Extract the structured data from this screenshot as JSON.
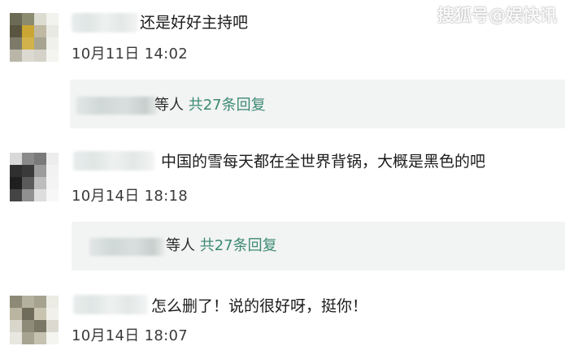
{
  "watermark": "搜狐号@娱快讯",
  "comments": [
    {
      "text": "还是好好主持吧",
      "time": "10月11日 14:02",
      "reply_suffix": "等人",
      "reply_count": "共27条回复",
      "avatar_colors": [
        "#6b6a55",
        "#8b8b70",
        "#dcdcd0",
        "#f2f2ee",
        "#5a5540",
        "#c9a634",
        "#bfb9a4",
        "#e9e9e4",
        "#7d7a6a",
        "#d2b24a",
        "#a8a492",
        "#f0f0ec",
        "#b9b6a8",
        "#dcdad0",
        "#d5d3c9",
        "#f4f4f1"
      ]
    },
    {
      "text": "中国的雪每天都在全世界背锅，大概是黑色的吧",
      "time": "10月14日 18:18",
      "reply_suffix": "等人",
      "reply_count": "共27条回复",
      "avatar_colors": [
        "#d9d9d9",
        "#8a8a8a",
        "#7a7a7a",
        "#ededed",
        "#2f2f2f",
        "#3a3a3a",
        "#9c9c9c",
        "#f2f2f2",
        "#1f1f1f",
        "#5a5a5a",
        "#bdbdbd",
        "#f4f4f4",
        "#444444",
        "#909090",
        "#dedede",
        "#f7f7f7"
      ]
    },
    {
      "text": "怎么删了！说的很好呀，挺你！",
      "time": "10月14日 18:07",
      "avatar_colors": [
        "#8c8a76",
        "#b4b19e",
        "#a5a290",
        "#ecebe4",
        "#b9b5a0",
        "#6f6c5b",
        "#c8c4b0",
        "#f1f0ea",
        "#d9d7cb",
        "#8e8b79",
        "#7a7766",
        "#dcdad0",
        "#e8e7e0",
        "#a7a492",
        "#c5c2b2",
        "#f4f4f0"
      ]
    }
  ]
}
